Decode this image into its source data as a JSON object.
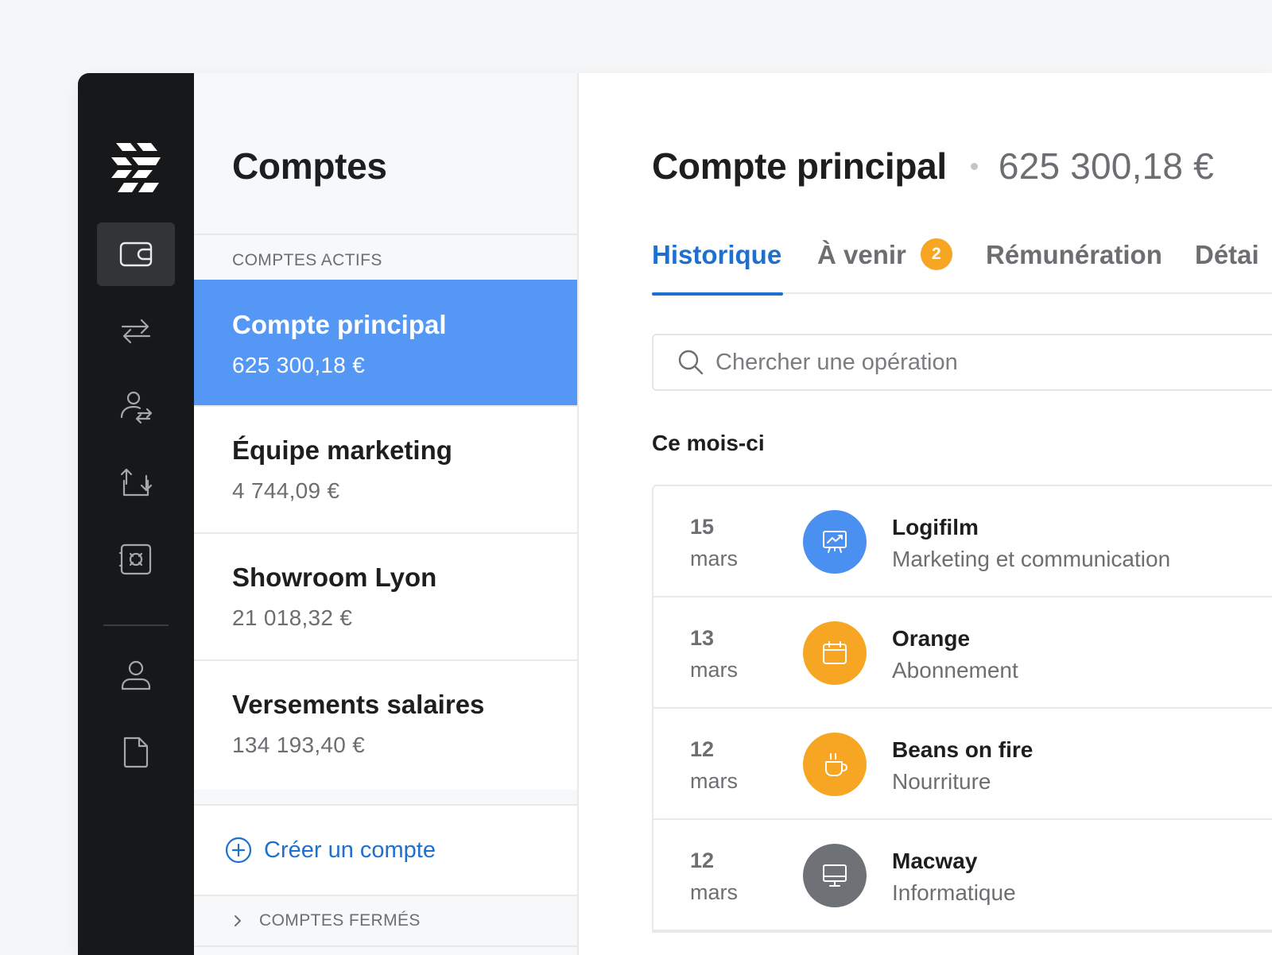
{
  "colors": {
    "rail_bg": "#17181a",
    "selected_account": "#5597f5",
    "accent_blue": "#1d6fd0",
    "badge_orange": "#f6a623",
    "icon_blue": "#4a90f0",
    "icon_orange": "#f6a623",
    "icon_grey": "#6e7176"
  },
  "rail": {
    "items": [
      {
        "icon": "wallet-icon",
        "active": true
      },
      {
        "icon": "transfer-arrows-icon"
      },
      {
        "icon": "beneficiary-transfer-icon"
      },
      {
        "icon": "recurring-transfer-icon"
      },
      {
        "icon": "safe-icon"
      },
      {
        "icon": "user-icon"
      },
      {
        "icon": "document-icon"
      }
    ]
  },
  "accounts_panel": {
    "title": "Comptes",
    "active_section": "COMPTES ACTIFS",
    "accounts": [
      {
        "name": "Compte principal",
        "amount": "625 300,18 €",
        "selected": true
      },
      {
        "name": "Équipe marketing",
        "amount": "4 744,09 €"
      },
      {
        "name": "Showroom Lyon",
        "amount": "21 018,32 €"
      },
      {
        "name": "Versements salaires",
        "amount": "134 193,40 €"
      }
    ],
    "create_label": "Créer un compte",
    "closed_section": "COMPTES FERMÉS"
  },
  "main": {
    "title": "Compte principal",
    "balance": "625 300,18 €",
    "tabs": [
      {
        "label": "Historique",
        "active": true
      },
      {
        "label": "À venir",
        "badge": "2"
      },
      {
        "label": "Rémunération"
      },
      {
        "label": "Détai"
      }
    ],
    "search_placeholder": "Chercher une opération",
    "period_label": "Ce mois-ci",
    "operations": [
      {
        "day": "15",
        "month": "mars",
        "name": "Logifilm",
        "category": "Marketing et communication",
        "icon": "presentation-chart-icon"
      },
      {
        "day": "13",
        "month": "mars",
        "name": "Orange",
        "category": "Abonnement",
        "icon": "calendar-icon"
      },
      {
        "day": "12",
        "month": "mars",
        "name": "Beans on fire",
        "category": "Nourriture",
        "icon": "coffee-cup-icon"
      },
      {
        "day": "12",
        "month": "mars",
        "name": "Macway",
        "category": "Informatique",
        "icon": "computer-monitor-icon"
      }
    ]
  }
}
